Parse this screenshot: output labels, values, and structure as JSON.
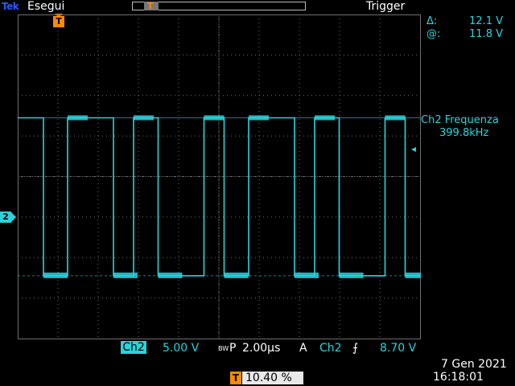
{
  "header": {
    "brand": "Tek",
    "run_state": "Esegui",
    "trigger_label": "Trigger"
  },
  "markers": {
    "trigger_position": "T",
    "channel": "2"
  },
  "cursors": {
    "delta_symbol": "Δ:",
    "delta_value": "12.1 V",
    "at_symbol": "@:",
    "at_value": "11.8 V"
  },
  "measurement": {
    "label": "Ch2 Frequenza",
    "value": "399.8kHz"
  },
  "status": {
    "channel": "Ch2",
    "volts_per_div": "5.00 V",
    "bw_symbol": "BW",
    "p_symbol": "P",
    "time_per_div": "2.00µs",
    "acq_mode": "A",
    "trigger_channel": "Ch2",
    "slope_symbol": "⨍",
    "trigger_level": "8.70 V",
    "t_label": "T",
    "horizontal_position": "10.40 %",
    "date": "7 Gen  2021",
    "time": "16:18:01"
  },
  "colors": {
    "channel2": "#28d4dc",
    "trigger": "#ff8a00",
    "grid": "#6e6e6e"
  },
  "chart_data": {
    "type": "line",
    "series": [
      {
        "name": "Ch2",
        "description_free": true,
        "x_divisions": [
          0.0,
          0.14,
          0.64,
          0.64,
          1.24,
          1.24,
          2.38,
          2.38,
          2.88,
          2.88,
          3.49,
          3.49,
          4.63,
          4.63,
          5.13,
          5.13,
          5.74,
          5.74,
          6.88,
          6.88,
          7.38,
          7.38,
          7.99,
          7.99,
          9.13,
          9.13,
          9.63,
          9.63,
          10.0
        ],
        "y_divisions": [
          1.45,
          1.45,
          1.45,
          -2.45,
          -2.45,
          1.45,
          1.45,
          -2.45,
          -2.45,
          1.45,
          1.45,
          -2.45,
          -2.45,
          1.45,
          1.45,
          -2.45,
          -2.45,
          1.45,
          1.45,
          -2.45,
          -2.45,
          1.45,
          1.45,
          -2.45,
          -2.45,
          1.45,
          1.45,
          -2.45,
          -2.45
        ]
      }
    ],
    "xlim": [
      0,
      10
    ],
    "ylim": [
      -4,
      4
    ],
    "grid": true
  }
}
